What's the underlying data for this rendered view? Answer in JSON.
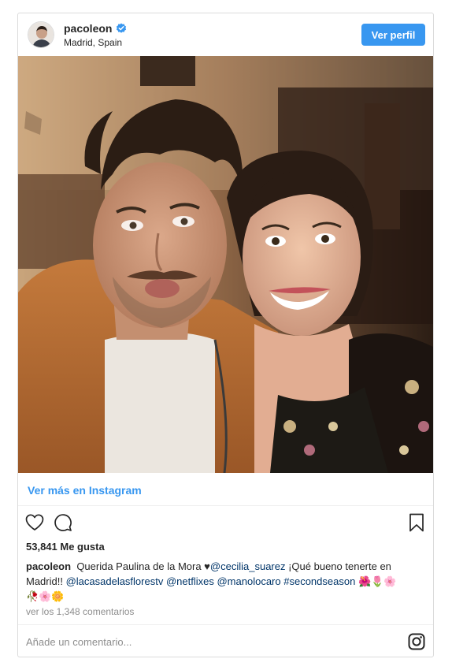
{
  "post": {
    "username": "pacoleon",
    "location": "Madrid, Spain",
    "view_profile": "Ver perfil",
    "view_more": "Ver más en Instagram",
    "likes": "53,841 Me gusta",
    "caption": {
      "username": "pacoleon",
      "text_1": "Querida Paulina de la Mora ♥",
      "mention_1": "@cecilia_suarez",
      "text_2": " ¡Qué bueno tenerte en Madrid!! ",
      "mention_2": "@lacasadelasflorestv",
      "mention_3": "@netflixes",
      "mention_4": "@manolocaro",
      "hashtag": "#secondseason",
      "emojis_1": "🌺🌷🌸",
      "emojis_2": "🥀🌸🌼"
    },
    "comments_link": "ver los 1,348 comentarios",
    "comment_placeholder": "Añade un comentario..."
  },
  "icons": {
    "verified": "verified-badge-icon",
    "like": "heart-icon",
    "comment": "comment-bubble-icon",
    "save": "bookmark-icon",
    "instagram": "instagram-logo-icon"
  },
  "colors": {
    "accent": "#3897f0",
    "link": "#003569",
    "muted": "#8e8e8e",
    "border": "#dbdbdb"
  }
}
